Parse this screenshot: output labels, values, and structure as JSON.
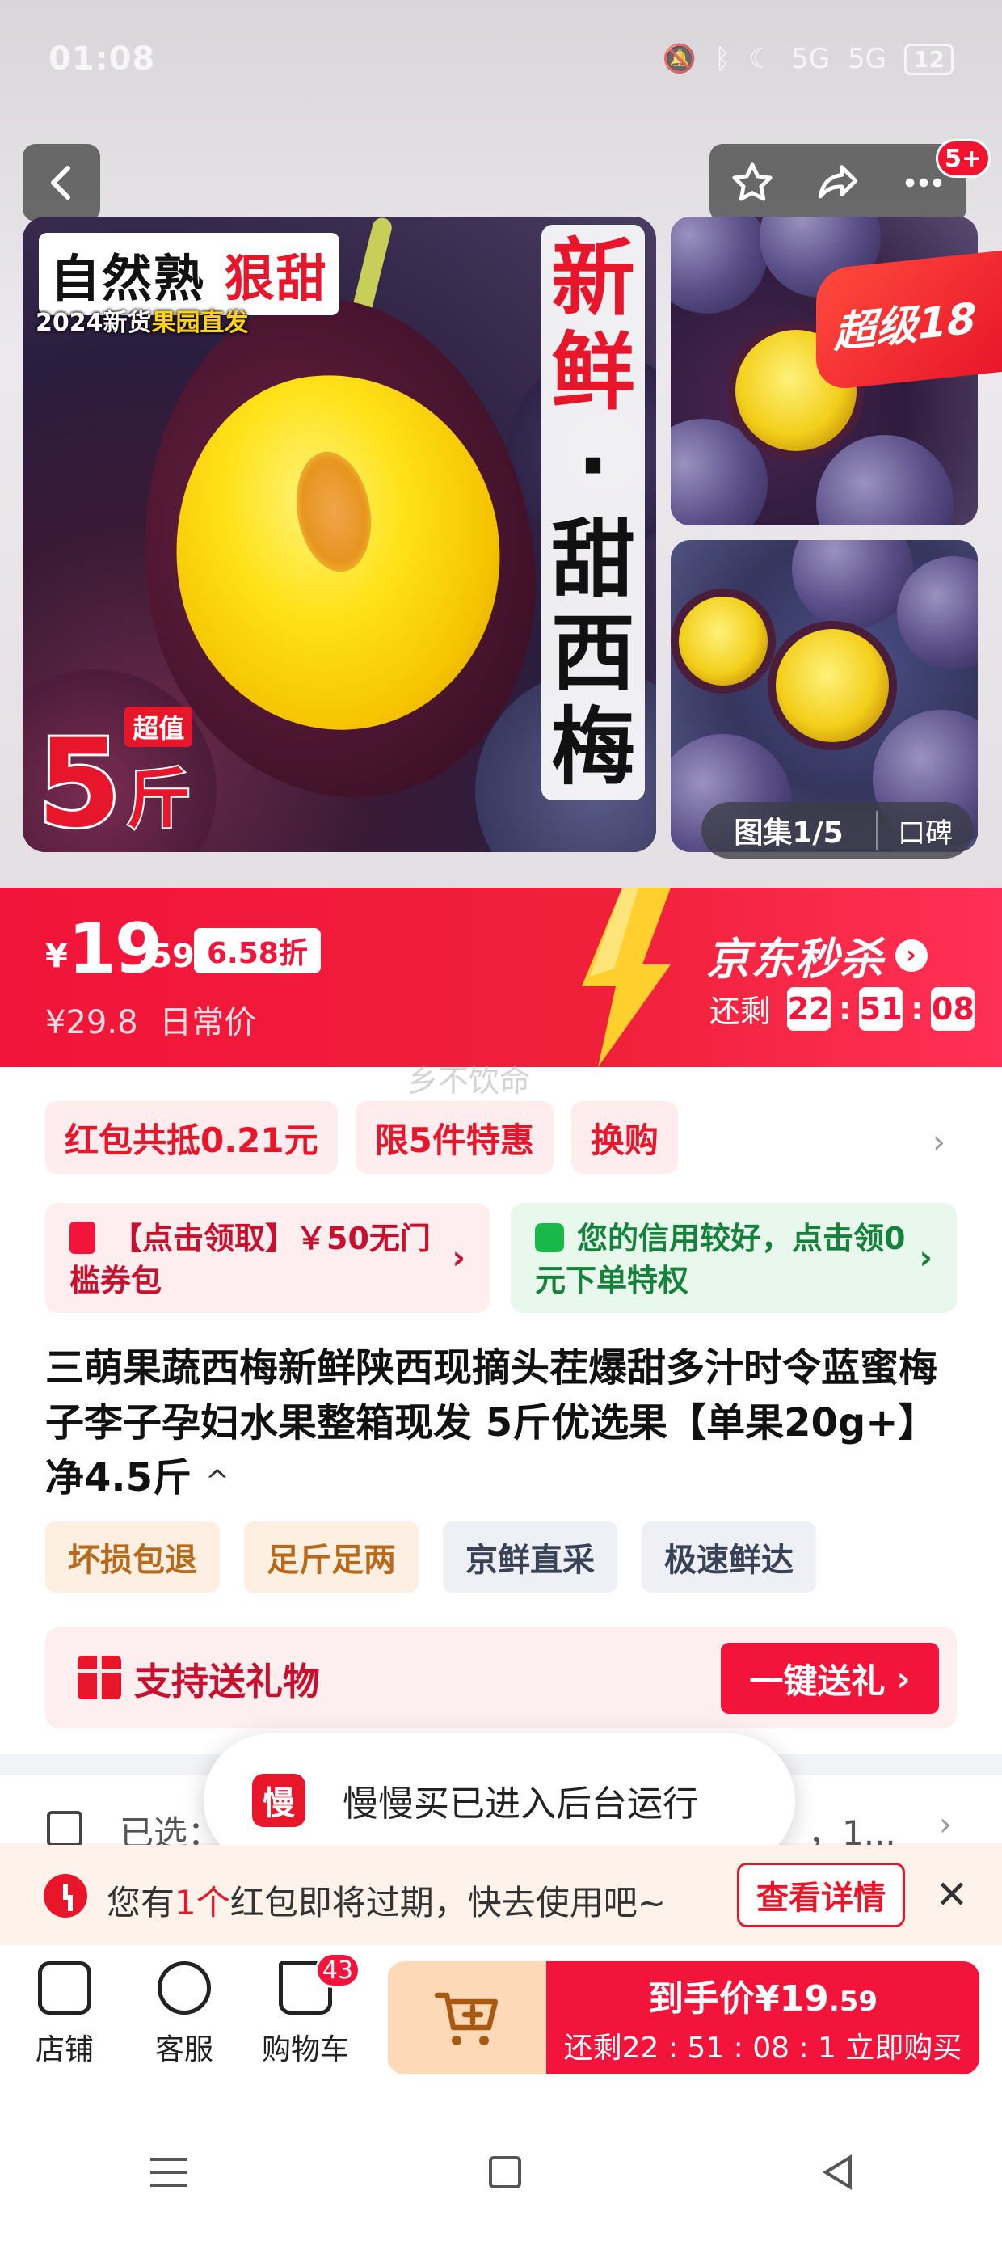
{
  "status_bar": {
    "time": "01:08",
    "battery": "12",
    "signal1": "5G",
    "signal2": "5G"
  },
  "header": {
    "notification_count": "5+"
  },
  "gallery": {
    "main_tag_left": "自然熟",
    "main_tag_right": "狠甜",
    "main_tag_sub_a": "2024新货",
    "main_tag_sub_b": "果园直发",
    "vertical_title": [
      "新",
      "鲜",
      "·",
      "甜",
      "西",
      "梅"
    ],
    "weight_num": "5",
    "weight_label": "超值",
    "weight_unit": "斤",
    "super_badge": "超级18",
    "counter": "图集1/5",
    "reputation": "口碑"
  },
  "price": {
    "currency": "¥",
    "integer": "19",
    "decimal": ".59",
    "discount": "6.58折",
    "original": "¥29.8",
    "original_label": "日常价",
    "seckill_label": "京东秒杀",
    "remaining_label": "还剩",
    "countdown": [
      "22",
      "51",
      "08"
    ]
  },
  "watermark": "乡不饮命",
  "promos": [
    "红包共抵0.21元",
    "限5件特惠",
    "换购"
  ],
  "coupon": {
    "text": "【点击领取】￥50无门槛券包"
  },
  "credit": {
    "text": "您的信用较好，点击领0元下单特权"
  },
  "product": {
    "title": "三萌果蔬西梅新鲜陕西现摘头茬爆甜多汁时令蓝蜜梅子李子孕妇水果整箱现发 5斤优选果【单果20g+】净4.5斤",
    "caret": "^",
    "tags_warm": [
      "坏损包退",
      "足斤足两"
    ],
    "tags_cool": [
      "京鲜直采",
      "极速鲜达"
    ]
  },
  "gift": {
    "label": "支持送礼物",
    "button": "一键送礼"
  },
  "selected": {
    "label": "已选：",
    "value": "，1..."
  },
  "toast": {
    "logo": "慢",
    "text": "慢慢买已进入后台运行"
  },
  "expire": {
    "prefix": "您有",
    "count": "1个",
    "suffix": "红包即将过期，快去使用吧~",
    "button": "查看详情"
  },
  "bottom_bar": {
    "shop": "店铺",
    "service": "客服",
    "cart": "购物车",
    "cart_count": "43",
    "buy_line1_prefix": "到手价¥19",
    "buy_line1_decimal": ".59",
    "buy_line2": "还剩22 : 51 : 08 : 1  立即购买"
  },
  "colors": {
    "brand_red": "#f2143a",
    "accent_yellow": "#ffd21a"
  }
}
